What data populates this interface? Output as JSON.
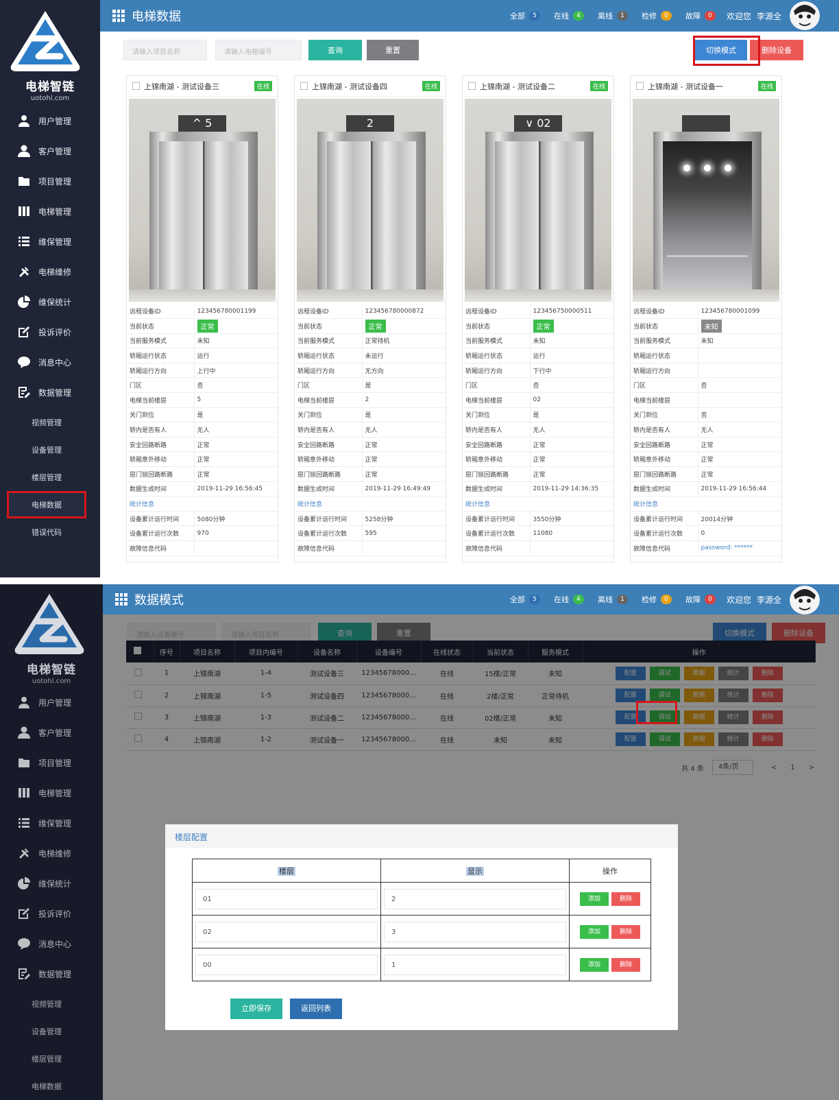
{
  "app": {
    "brand": "电梯智链",
    "domain": "uotohl.com"
  },
  "nav": [
    {
      "label": "用户管理",
      "icon": "user-icon"
    },
    {
      "label": "客户管理",
      "icon": "customer-icon"
    },
    {
      "label": "项目管理",
      "icon": "folder-icon"
    },
    {
      "label": "电梯管理",
      "icon": "elevator-icon"
    },
    {
      "label": "维保管理",
      "icon": "list-icon"
    },
    {
      "label": "电梯维修",
      "icon": "tools-icon"
    },
    {
      "label": "维保统计",
      "icon": "pie-chart-icon"
    },
    {
      "label": "投诉评价",
      "icon": "edit-icon"
    },
    {
      "label": "消息中心",
      "icon": "chat-icon"
    },
    {
      "label": "数据管理",
      "icon": "data-icon"
    }
  ],
  "subnav": [
    "视频管理",
    "设备管理",
    "楼层管理",
    "电梯数据",
    "错误代码"
  ],
  "shot1": {
    "title": "电梯数据",
    "stats": [
      {
        "label": "全部",
        "count": "5",
        "color": "#2f6fb0"
      },
      {
        "label": "在线",
        "count": "4",
        "color": "#3bbd4c"
      },
      {
        "label": "离线",
        "count": "1",
        "color": "#666666"
      },
      {
        "label": "检修",
        "count": "0",
        "color": "#e8a317"
      },
      {
        "label": "故障",
        "count": "0",
        "color": "#d9443f"
      }
    ],
    "welcome": "欢迎您",
    "user": "李源全",
    "search": {
      "project_placeholder": "请输入项目名称",
      "elevator_placeholder": "请输入电梯编号",
      "query": "查询",
      "reset": "重置"
    },
    "switch_mode": "切换模式",
    "delete_device": "删除设备",
    "labels": [
      "远程设备ID",
      "当前状态",
      "当前服务模式",
      "轿厢运行状态",
      "轿厢运行方向",
      "门区",
      "电梯当前楼层",
      "关门到位",
      "轿内是否有人",
      "安全回路断路",
      "轿厢意外移动",
      "层门锁回路断路",
      "数据生成时间",
      "统计信息",
      "设备累计运行时间",
      "设备累计运行次数",
      "故障信息代码"
    ],
    "cards": [
      {
        "name": "上锦南湖 - 测试设备三",
        "online": "在线",
        "floor_display": "^ 5",
        "doors": "closed",
        "values": [
          "123456780001199",
          "正常",
          "未知",
          "运行",
          "上行中",
          "否",
          "5",
          "是",
          "无人",
          "正常",
          "正常",
          "正常",
          "2019-11-29 16:56:45",
          "",
          "5080分钟",
          "970",
          ""
        ]
      },
      {
        "name": "上锦南湖 - 测试设备四",
        "online": "在线",
        "floor_display": "2",
        "doors": "closed",
        "values": [
          "123456780000872",
          "正常",
          "正常待机",
          "未运行",
          "无方向",
          "是",
          "2",
          "是",
          "无人",
          "正常",
          "正常",
          "正常",
          "2019-11-29 16:49:49",
          "",
          "5258分钟",
          "595",
          ""
        ]
      },
      {
        "name": "上锦南湖 - 测试设备二",
        "online": "在线",
        "floor_display": "∨ 02",
        "doors": "closed",
        "values": [
          "123456750000511",
          "正常",
          "未知",
          "运行",
          "下行中",
          "否",
          "02",
          "是",
          "无人",
          "正常",
          "正常",
          "正常",
          "2019-11-29 14:36:35",
          "",
          "3550分钟",
          "11080",
          ""
        ]
      },
      {
        "name": "上锦南湖 - 测试设备一",
        "online": "在线",
        "floor_display": "",
        "doors": "open",
        "values": [
          "123456780001099",
          "未知",
          "未知",
          "",
          "",
          "否",
          "",
          "否",
          "无人",
          "正常",
          "正常",
          "正常",
          "2019-11-29 16:56:44",
          "",
          "20014分钟",
          "0",
          "password: ******"
        ]
      }
    ]
  },
  "shot2": {
    "title": "数据模式",
    "stats": [
      {
        "label": "全部",
        "count": "5",
        "color": "#2f6fb0"
      },
      {
        "label": "在线",
        "count": "4",
        "color": "#3bbd4c"
      },
      {
        "label": "离线",
        "count": "1",
        "color": "#666666"
      },
      {
        "label": "检修",
        "count": "0",
        "color": "#e8a317"
      },
      {
        "label": "故障",
        "count": "0",
        "color": "#d9443f"
      }
    ],
    "welcome": "欢迎您",
    "user": "李源全",
    "search": {
      "device_placeholder": "请输入设备编号",
      "project_placeholder": "请输入项目名称",
      "query": "查询",
      "reset": "重置"
    },
    "switch_mode": "切换模式",
    "delete_device": "删除设备",
    "columns": [
      "序号",
      "项目名称",
      "项目内编号",
      "设备名称",
      "设备编号",
      "在线状态",
      "当前状态",
      "服务模式",
      "操作"
    ],
    "rows": [
      {
        "no": "1",
        "project": "上锦南湖",
        "inner": "1-4",
        "device": "测试设备三",
        "code": "12345678000...",
        "online": "在线",
        "state": "15楼/正常",
        "mode": "未知"
      },
      {
        "no": "2",
        "project": "上锦南湖",
        "inner": "1-5",
        "device": "测试设备四",
        "code": "12345678000...",
        "online": "在线",
        "state": "2楼/正常",
        "mode": "正常待机"
      },
      {
        "no": "3",
        "project": "上锦南湖",
        "inner": "1-3",
        "device": "测试设备二",
        "code": "12345678000...",
        "online": "在线",
        "state": "02楼/正常",
        "mode": "未知"
      },
      {
        "no": "4",
        "project": "上锦南湖",
        "inner": "1-2",
        "device": "测试设备一",
        "code": "12345678000...",
        "online": "在线",
        "state": "未知",
        "mode": "未知"
      }
    ],
    "row_ops": [
      "配置",
      "调试",
      "数据",
      "统计",
      "删除"
    ],
    "pager": {
      "total": "共 4 条",
      "size": "4条/页",
      "prev": "<",
      "page": "1",
      "next": ">"
    },
    "modal": {
      "title": "楼层配置",
      "col_floor": "楼层",
      "col_display": "显示",
      "col_op": "操作",
      "rows": [
        {
          "floor": "01",
          "display": "2"
        },
        {
          "floor": "02",
          "display": "3"
        },
        {
          "floor": "00",
          "display": "1"
        }
      ],
      "add": "添加",
      "del": "删除",
      "save": "立即保存",
      "back": "返回列表"
    }
  }
}
